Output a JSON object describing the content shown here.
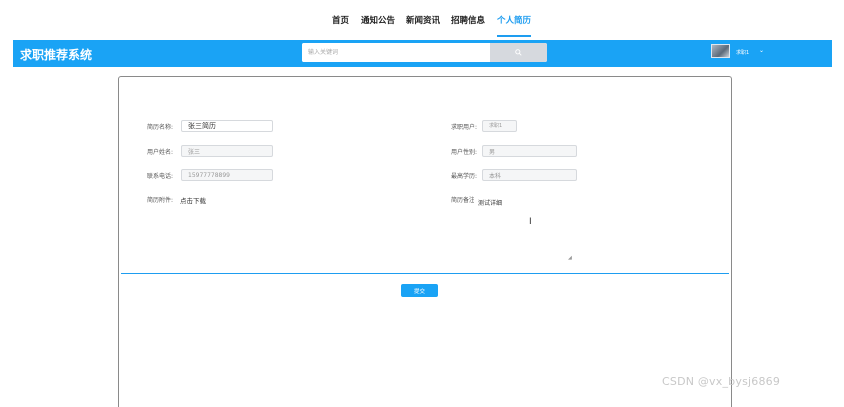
{
  "nav": {
    "items": [
      {
        "label": "首页"
      },
      {
        "label": "通知公告"
      },
      {
        "label": "新闻资讯"
      },
      {
        "label": "招聘信息"
      },
      {
        "label": "个人简历",
        "active": true
      }
    ]
  },
  "header": {
    "logo": "求职推荐系统",
    "search_placeholder": "输入关键词",
    "username": "求职1",
    "accent": "#1aa3f5"
  },
  "form": {
    "resume_name": {
      "label": "简历名称:",
      "value": "张三简历"
    },
    "job_seeker": {
      "label": "求职用户:",
      "value": "求职1"
    },
    "user_name": {
      "label": "用户姓名:",
      "value": "张三"
    },
    "user_gender": {
      "label": "用户性别:",
      "value": "男"
    },
    "phone": {
      "label": "联系电话:",
      "value": "15977778899"
    },
    "education": {
      "label": "最高学历:",
      "value": "本科"
    },
    "attachment": {
      "label": "简历附件:",
      "link": "点击下载"
    },
    "remark": {
      "label": "简历备注:",
      "value": "测试详细"
    },
    "submit_label": "提交"
  },
  "watermark": "CSDN @vx_bysj6869"
}
